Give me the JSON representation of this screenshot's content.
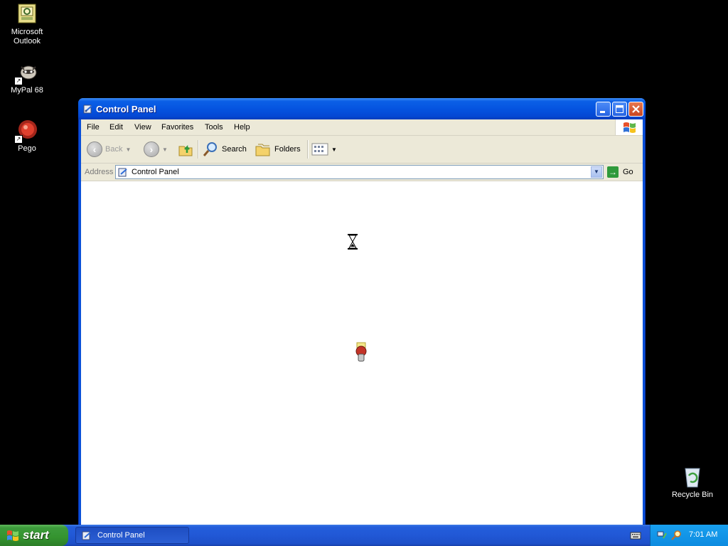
{
  "desktop": {
    "icons": [
      {
        "label": "Microsoft Outlook",
        "icon": "outlook-icon"
      },
      {
        "label": "MyPal 68",
        "icon": "mypal-icon"
      },
      {
        "label": "Pego",
        "icon": "pego-icon"
      },
      {
        "label": "Recycle Bin",
        "icon": "recycle-bin-icon"
      }
    ]
  },
  "window": {
    "title": "Control Panel",
    "menu": [
      "File",
      "Edit",
      "View",
      "Favorites",
      "Tools",
      "Help"
    ],
    "toolbar": {
      "back_label": "Back",
      "search_label": "Search",
      "folders_label": "Folders"
    },
    "address": {
      "label": "Address",
      "value": "Control Panel",
      "go_label": "Go"
    }
  },
  "taskbar": {
    "start_label": "start",
    "task_label": "Control Panel",
    "clock": "7:01 AM"
  },
  "colors": {
    "titlebar": "#0554e0",
    "taskbar": "#245edb",
    "start": "#3c9b3b",
    "tray": "#0d8be0"
  }
}
